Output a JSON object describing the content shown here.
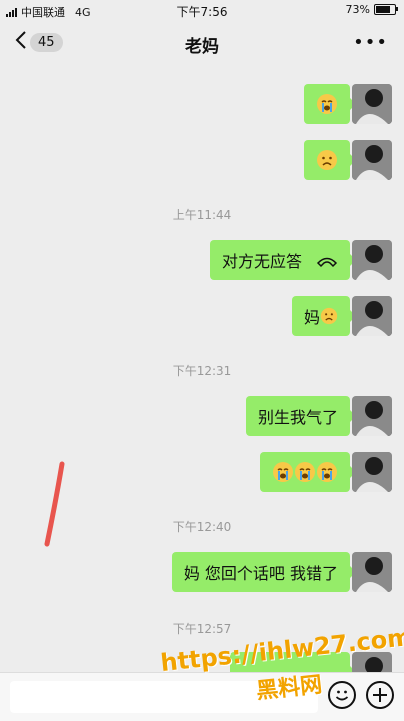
{
  "status_bar": {
    "carrier": "中国联通",
    "network": "4G",
    "time": "下午7:56",
    "battery": "73%"
  },
  "nav": {
    "back_count": "45",
    "title": "老妈",
    "more": "•••"
  },
  "messages": {
    "m1_emoji": "crying-face",
    "m2_emoji": "frowning-face",
    "time1": "上午11:44",
    "m3_text": "对方无应答",
    "m4_text": "妈",
    "time2": "下午12:31",
    "m5_text": "别生我气了",
    "m6_emoji": "crying-face x3",
    "time3": "下午12:40",
    "m7_text": "妈 您回个话吧 我错了",
    "time4": "下午12:57"
  },
  "watermark": {
    "line1": "https://ihlw27.com",
    "line2": "黑料网"
  },
  "colors": {
    "bubble": "#95ec69",
    "background": "#ededed",
    "time_text": "#999999",
    "watermark": "#f2a300"
  }
}
